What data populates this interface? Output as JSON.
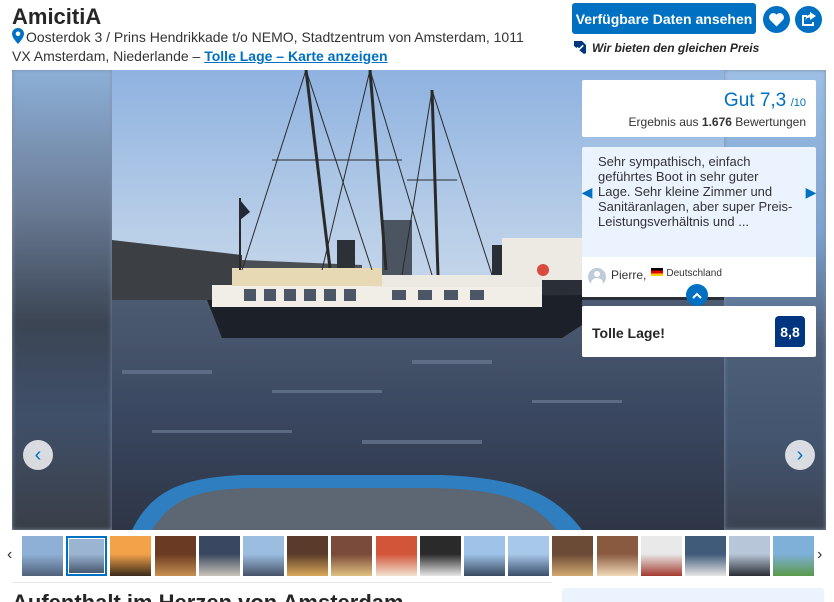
{
  "hotel": {
    "name": "AmicitiA",
    "address": "Oosterdok 3 / Prins Hendrikkade t/o NEMO, Stadtzentrum von Amsterdam, 1011 VX Amsterdam, Niederlande –",
    "map_link": "Tolle Lage – Karte anzeigen"
  },
  "actions": {
    "cta_label": "Verfügbare Daten ansehen",
    "price_match": "Wir bieten den gleichen Preis",
    "favorite_icon": "heart-icon",
    "share_icon": "share-icon"
  },
  "score": {
    "word": "Gut 7,3",
    "max": "/10",
    "prefix": "Ergebnis aus",
    "count": "1.676",
    "suffix": "Bewertungen"
  },
  "review": {
    "text": "Sehr sympathisch, einfach geführtes Boot in sehr guter Lage. Sehr kleine Zimmer und Sanitäranlagen, aber super Preis-Leistungsverhältnis und ...",
    "author": "Pierre,",
    "country": "Deutschland"
  },
  "subscore": {
    "label": "Tolle Lage!",
    "value": "8,8"
  },
  "gallery": {
    "thumbnail_count": 18,
    "active_thumbnail": 2
  },
  "below": {
    "heading": "Aufenthalt im Herzen von Amsterdam"
  },
  "colors": {
    "brand_blue": "#0071c2",
    "dark_blue": "#003580",
    "light_blue_bg": "#ebf3ff"
  }
}
